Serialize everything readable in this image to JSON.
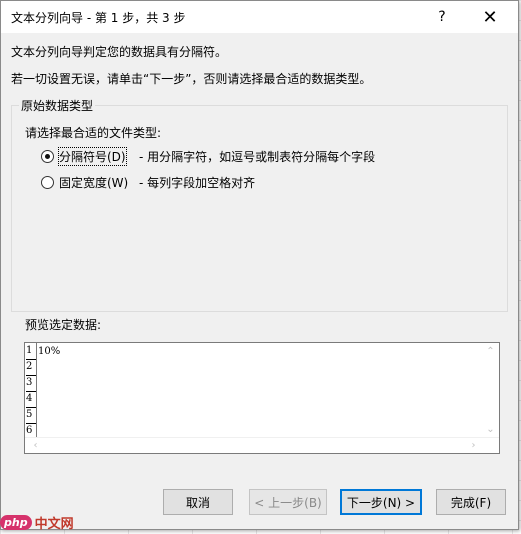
{
  "window": {
    "title": "文本分列向导 - 第 1 步，共 3 步",
    "help_glyph": "?",
    "close_glyph": "✕"
  },
  "intro": {
    "line1": "文本分列向导判定您的数据具有分隔符。",
    "line2": "若一切设置无误，请单击“下一步”，否则请选择最合适的数据类型。"
  },
  "group": {
    "label": "原始数据类型",
    "choose_label": "请选择最合适的文件类型:",
    "options": [
      {
        "label": "分隔符号(D)",
        "desc": "- 用分隔字符，如逗号或制表符分隔每个字段",
        "checked": true
      },
      {
        "label": "固定宽度(W)",
        "desc": "- 每列字段加空格对齐",
        "checked": false
      }
    ]
  },
  "preview": {
    "label": "预览选定数据:",
    "row_numbers": [
      "1",
      "2",
      "3",
      "4",
      "5",
      "6"
    ],
    "rows": [
      "10%"
    ]
  },
  "buttons": {
    "cancel": "取消",
    "back": "< 上一步(B)",
    "next": "下一步(N) >",
    "finish": "完成(F)"
  },
  "watermark": {
    "logo": "php",
    "text": "中文网"
  },
  "colors": {
    "dialog_bg": "#f0f0f0",
    "focus_border": "#0078d7"
  }
}
